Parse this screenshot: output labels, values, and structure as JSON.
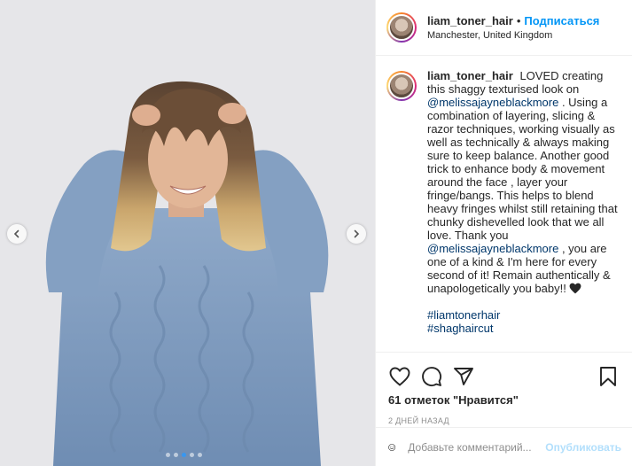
{
  "post": {
    "username": "liam_toner_hair",
    "bullet": "•",
    "follow_label": "Подписаться",
    "location": "Manchester, United Kingdom"
  },
  "caption": {
    "username": "liam_toner_hair",
    "part1": "LOVED creating this shaggy texturised look on",
    "mention1": "@melissajayneblackmore",
    "part2": ". Using a combination of layering, slicing & razor techniques, working visually as well as technically & always making sure to keep balance. Another good trick to enhance body & movement around the face , layer your fringe/bangs. This helps to blend heavy fringes whilst still retaining that chunky dishevelled look that we all love. Thank you",
    "mention2": "@melissajayneblackmore",
    "part3": ", you are one of a kind & I'm here for every second of it! Remain authentically & unapologetically you baby!!",
    "hashtags": [
      "#liamtonerhair",
      "#shaghaircut"
    ]
  },
  "actions": {
    "likes": "61 отметок \"Нравится\"",
    "date": "2 ДНЕЙ НАЗАД"
  },
  "comment_box": {
    "placeholder": "Добавьте комментарий...",
    "publish_label": "Опубликовать"
  },
  "carousel": {
    "count": 5,
    "active": 2
  },
  "icons": [
    "chevron-left-icon",
    "chevron-right-icon",
    "heart-icon",
    "comment-icon",
    "share-icon",
    "bookmark-icon",
    "emoji-icon",
    "black-heart-icon"
  ],
  "colors": {
    "link": "#00376b",
    "follow": "#0095f6",
    "publish_disabled": "#b2dffc",
    "active_dot": "#3897f0"
  }
}
